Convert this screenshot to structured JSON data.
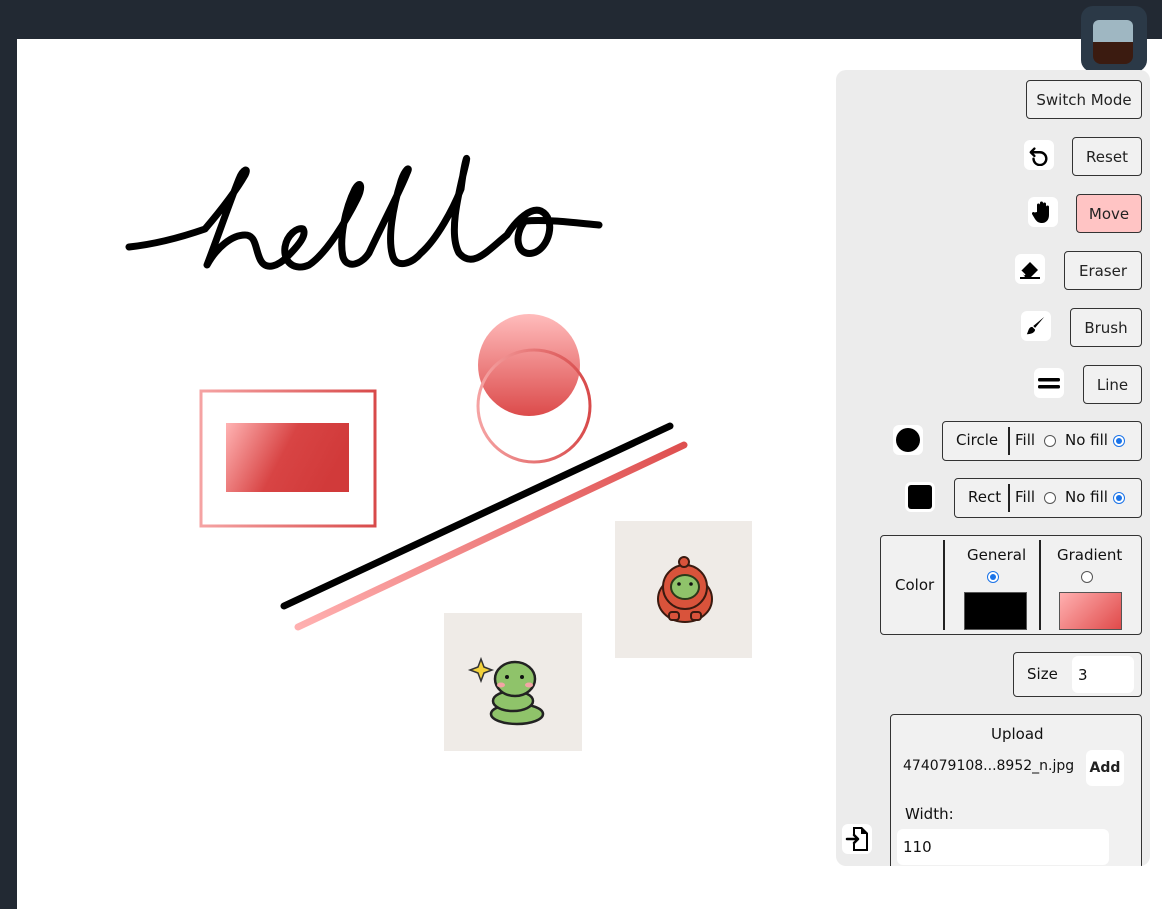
{
  "canvas": {
    "handwriting_text": "hello"
  },
  "toolbar": {
    "switch_mode": "Switch Mode",
    "reset": "Reset",
    "move": "Move",
    "eraser": "Eraser",
    "brush": "Brush",
    "line": "Line",
    "circle": {
      "label": "Circle",
      "fill": "Fill",
      "no_fill": "No fill",
      "selected": "no_fill"
    },
    "rect": {
      "label": "Rect",
      "fill": "Fill",
      "no_fill": "No fill",
      "selected": "no_fill"
    },
    "color": {
      "label": "Color",
      "general": "General",
      "gradient": "Gradient",
      "selected": "general",
      "general_color": "#000000",
      "gradient_from": "#ffb0b0",
      "gradient_to": "#e04a4a"
    },
    "size": {
      "label": "Size",
      "value": "3"
    },
    "upload": {
      "title": "Upload",
      "filename": "474079108...8952_n.jpg",
      "add": "Add",
      "width_label": "Width:",
      "width_value": "110"
    }
  },
  "colors": {
    "active_button": "#ffc4c4",
    "panel_bg": "#ececec",
    "accent_radio": "#1a73e8",
    "page_bg": "#222933"
  },
  "icons": [
    "undo-icon",
    "hand-icon",
    "eraser-icon",
    "brush-icon",
    "line-icon",
    "circle-icon",
    "square-icon",
    "file-import-icon"
  ]
}
